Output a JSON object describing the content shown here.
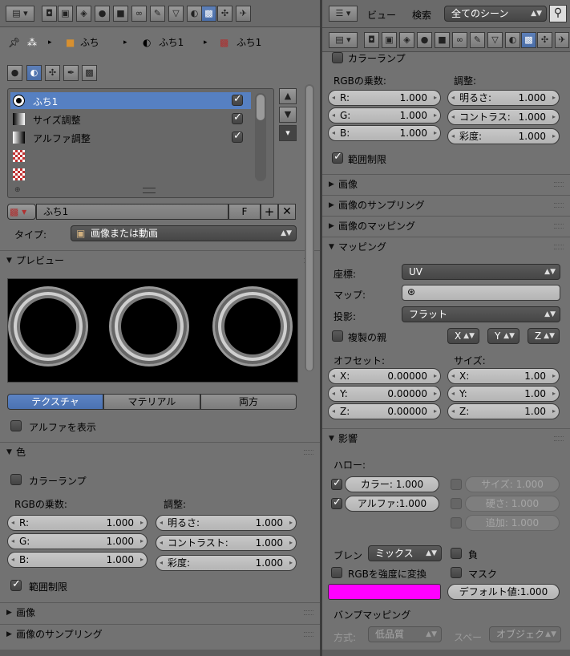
{
  "left": {
    "breadcrumb": [
      "ふち",
      "ふち1",
      "ふち1"
    ],
    "tex_slots": [
      {
        "label": "ふち1",
        "checked": true,
        "selected": true
      },
      {
        "label": "サイズ調整",
        "checked": true,
        "selected": false
      },
      {
        "label": "アルファ調整",
        "checked": true,
        "selected": false
      },
      {
        "label": "",
        "checked": false,
        "selected": false
      },
      {
        "label": "",
        "checked": false,
        "selected": false
      }
    ],
    "texture_name": "ふち1",
    "fake_user": "F",
    "type_label": "タイプ:",
    "type_value": "画像または動画",
    "preview_title": "プレビュー",
    "preview_tabs": [
      "テクスチャ",
      "マテリアル",
      "両方"
    ],
    "show_alpha": "アルファを表示",
    "color_title": "色",
    "color_ramp": "カラーランプ",
    "rgb_mult": "RGBの乗数:",
    "adjust": "調整:",
    "rgb": [
      {
        "l": "R:",
        "v": "1.000"
      },
      {
        "l": "G:",
        "v": "1.000"
      },
      {
        "l": "B:",
        "v": "1.000"
      }
    ],
    "adj": [
      {
        "l": "明るさ:",
        "v": "1.000"
      },
      {
        "l": "コントラスト:",
        "v": "1.000"
      },
      {
        "l": "彩度:",
        "v": "1.000"
      }
    ],
    "clamp": "範囲制限",
    "image_title": "画像",
    "sampling_title": "画像のサンプリング"
  },
  "right": {
    "header_view": "ビュー",
    "header_search": "検索",
    "scene_select": "全てのシーン",
    "color_ramp": "カラーランプ",
    "rgb_mult": "RGBの乗数:",
    "adjust": "調整:",
    "rgb": [
      {
        "l": "R:",
        "v": "1.000"
      },
      {
        "l": "G:",
        "v": "1.000"
      },
      {
        "l": "B:",
        "v": "1.000"
      }
    ],
    "adj": [
      {
        "l": "明るさ:",
        "v": "1.000"
      },
      {
        "l": "コントラス:",
        "v": "1.000"
      },
      {
        "l": "彩度:",
        "v": "1.000"
      }
    ],
    "clamp": "範囲制限",
    "image_title": "画像",
    "sampling_title": "画像のサンプリング",
    "mapping_img_title": "画像のマッピング",
    "mapping_title": "マッピング",
    "coords_label": "座標:",
    "coords_value": "UV",
    "map_label": "マップ:",
    "projection_label": "投影:",
    "projection_value": "フラット",
    "dupli": "複製の親",
    "xyz": [
      "X",
      "Y",
      "Z"
    ],
    "offset_label": "オフセット:",
    "size_label": "サイズ:",
    "offset": [
      {
        "l": "X:",
        "v": "0.00000"
      },
      {
        "l": "Y:",
        "v": "0.00000"
      },
      {
        "l": "Z:",
        "v": "0.00000"
      }
    ],
    "size": [
      {
        "l": "X:",
        "v": "1.00"
      },
      {
        "l": "Y:",
        "v": "1.00"
      },
      {
        "l": "Z:",
        "v": "1.00"
      }
    ],
    "influence_title": "影響",
    "halo_label": "ハロー:",
    "halo_color": {
      "l": "カラー:",
      "v": "1.000"
    },
    "halo_alpha": {
      "l": "アルファ:",
      "v": "1.000"
    },
    "halo_size": {
      "l": "サイズ:",
      "v": "1.000"
    },
    "halo_hard": {
      "l": "硬さ:",
      "v": "1.000"
    },
    "halo_add": {
      "l": "追加:",
      "v": "1.000"
    },
    "blend_label": "ブレン",
    "blend_value": "ミックス",
    "negative": "負",
    "rgb_to_int": "RGBを強度に変換",
    "stencil": "マスク",
    "color_swatch": "#ff00ff",
    "default_value": {
      "l": "デフォルト値:",
      "v": "1.000"
    },
    "bump_title": "バンプマッピング",
    "method_label": "方式:",
    "method_value": "低品質",
    "space_label": "スペー",
    "space_value": "オブジェク"
  },
  "colors": {
    "selected": "#5680c2",
    "panel": "#727272",
    "magenta": "#ff00ff"
  }
}
